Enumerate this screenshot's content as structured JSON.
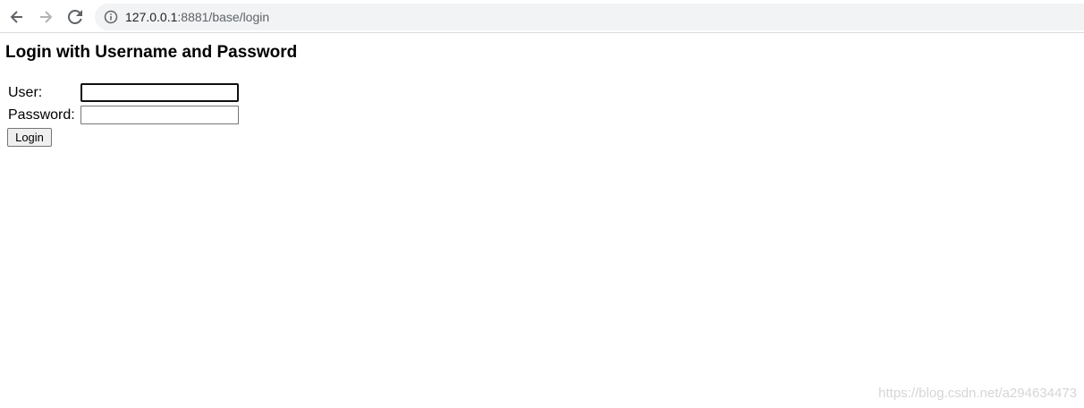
{
  "browser": {
    "url_host": "127.0.0.1",
    "url_rest": ":8881/base/login",
    "icons": {
      "back": "arrow-left-icon",
      "forward": "arrow-right-icon",
      "reload": "reload-icon",
      "site_info": "info-icon"
    }
  },
  "page": {
    "title": "Login with Username and Password",
    "form": {
      "user_label": "User:",
      "user_value": "",
      "password_label": "Password:",
      "password_value": "",
      "submit_label": "Login"
    },
    "watermark": "https://blog.csdn.net/a294634473"
  },
  "colors": {
    "omnibox_bg": "#f1f3f4",
    "focus_border": "#101010"
  }
}
